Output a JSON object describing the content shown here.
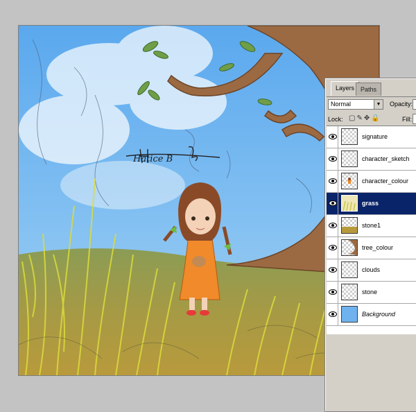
{
  "artwork": {
    "signature_text": "Hatice B"
  },
  "panel": {
    "tabs": [
      {
        "label": "Layers",
        "active": true
      },
      {
        "label": "Paths",
        "active": false
      }
    ],
    "blend_mode": "Normal",
    "opacity_label": "Opacity:",
    "lock_label": "Lock:",
    "fill_label": "Fill:",
    "layers": [
      {
        "name": "signature",
        "visible": true,
        "thumb": "transparent"
      },
      {
        "name": "character_sketch",
        "visible": true,
        "thumb": "transparent"
      },
      {
        "name": "character_colour",
        "visible": true,
        "thumb": "character"
      },
      {
        "name": "grass",
        "visible": true,
        "thumb": "grass",
        "selected": true
      },
      {
        "name": "stone1",
        "visible": true,
        "thumb": "stone"
      },
      {
        "name": "tree_colour",
        "visible": true,
        "thumb": "tree"
      },
      {
        "name": "clouds",
        "visible": true,
        "thumb": "transparent"
      },
      {
        "name": "stone",
        "visible": true,
        "thumb": "transparent"
      },
      {
        "name": "Background",
        "visible": true,
        "thumb": "background",
        "italic": true
      }
    ]
  },
  "colors": {
    "selection": "#0a246a",
    "sky": "#6fb2ee",
    "tree": "#9b6a43",
    "dress": "#f08a2a",
    "grass": "#c9c84a"
  }
}
